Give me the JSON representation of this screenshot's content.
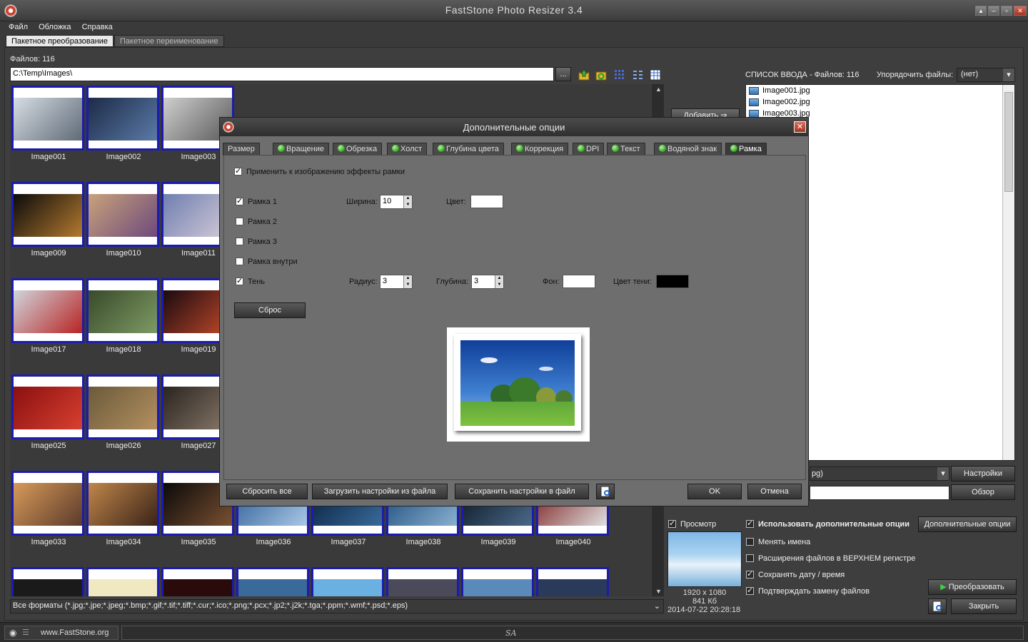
{
  "app": {
    "title": "FastStone Photo Resizer 3.4"
  },
  "menu": [
    "Файл",
    "Обложка",
    "Справка"
  ],
  "tabs": {
    "batch_convert": "Пакетное преобразование",
    "batch_rename": "Пакетное переименование"
  },
  "files_count": "Файлов: 116",
  "path": {
    "value": "C:\\Temp\\Images\\",
    "browse_label": "..."
  },
  "thumbnails": [
    {
      "label": "Image001",
      "c1": "#d7dde3",
      "c2": "#5f6b78"
    },
    {
      "label": "Image002",
      "c1": "#1d2b47",
      "c2": "#5a7aa7"
    },
    {
      "label": "Image003",
      "c1": "#cfcfcf",
      "c2": "#5a5a5a"
    },
    {
      "label": "Image009",
      "c1": "#0b0b0b",
      "c2": "#b47a2f"
    },
    {
      "label": "Image010",
      "c1": "#c8a27a",
      "c2": "#6e4a7c"
    },
    {
      "label": "Image011",
      "c1": "#6f7fb0",
      "c2": "#d6ccd8"
    },
    {
      "label": "Image017",
      "c1": "#d0d6dc",
      "c2": "#b82424"
    },
    {
      "label": "Image018",
      "c1": "#394a2a",
      "c2": "#7d9a64"
    },
    {
      "label": "Image019",
      "c1": "#1a0a10",
      "c2": "#c24a2a"
    },
    {
      "label": "Image025",
      "c1": "#8a1010",
      "c2": "#d84030"
    },
    {
      "label": "Image026",
      "c1": "#6a5a3a",
      "c2": "#b49060"
    },
    {
      "label": "Image027",
      "c1": "#2a2420",
      "c2": "#8a7a6a"
    },
    {
      "label": "Image033",
      "c1": "#d89a5a",
      "c2": "#5a3a2a"
    },
    {
      "label": "Image034",
      "c1": "#c0864a",
      "c2": "#3a2418"
    },
    {
      "label": "Image035",
      "c1": "#0a0a0a",
      "c2": "#7a5030"
    },
    {
      "label": "Image036",
      "c1": "#2c5c96",
      "c2": "#aac8e6"
    },
    {
      "label": "Image037",
      "c1": "#06203c",
      "c2": "#3a6a9a"
    },
    {
      "label": "Image038",
      "c1": "#1a4a7a",
      "c2": "#8ab0d0"
    },
    {
      "label": "Image039",
      "c1": "#0a1420",
      "c2": "#4a6a8a"
    },
    {
      "label": "Image040",
      "c1": "#7a1a1a",
      "c2": "#e0e0e0"
    }
  ],
  "format_filter": "Все форматы (*.jpg;*.jpe;*.jpeg;*.bmp;*.gif;*.tif;*.tiff;*.cur;*.ico;*.png;*.pcx;*.jp2;*.j2k;*.tga;*.ppm;*.wmf;*.psd;*.eps)",
  "input_list": {
    "header": "СПИСОК ВВОДА  -  Файлов: 116",
    "sort_label": "Упорядочить файлы:",
    "sort_value": "(нет)",
    "files": [
      "Image001.jpg",
      "Image002.jpg",
      "Image003.jpg"
    ]
  },
  "add_button": "Добавить",
  "output": {
    "format_value": "pg)",
    "settings_button": "Настройки",
    "browse_button": "Обзор"
  },
  "preview": {
    "label": "Просмотр",
    "resolution": "1920 x 1080",
    "size": "841 Кб",
    "date": "2014-07-22 20:28:18"
  },
  "options": {
    "use_advanced": "Использовать дополнительные опции",
    "advanced_button": "Дополнительные опции",
    "rename": "Менять имена",
    "uppercase_ext": "Расширения файлов в ВЕРХНЕМ регистре",
    "keep_date": "Сохранять дату / время",
    "confirm_replace": "Подтверждать замену файлов"
  },
  "convert_button": "Преобразовать",
  "close_button": "Закрыть",
  "status": {
    "url": "www.FastStone.org",
    "center": "SA"
  },
  "dialog": {
    "title": "Дополнительные опции",
    "tabs": [
      "Размер",
      "Вращение",
      "Обрезка",
      "Холст",
      "Глубина цвета",
      "Коррекция",
      "DPI",
      "Текст",
      "Водяной знак",
      "Рамка"
    ],
    "apply_frame": "Применить к изображению эффекты рамки",
    "frame1": "Рамка 1",
    "frame2": "Рамка 2",
    "frame3": "Рамка 3",
    "frame_inside": "Рамка внутри",
    "shadow": "Тень",
    "width_label": "Ширина:",
    "width_value": "10",
    "color_label": "Цвет:",
    "radius_label": "Радиус:",
    "radius_value": "3",
    "depth_label": "Глубина:",
    "depth_value": "3",
    "bg_label": "Фон:",
    "shadow_color_label": "Цвет тени:",
    "reset": "Сброс",
    "reset_all": "Сбросить все",
    "load_settings": "Загрузить настройки из файла",
    "save_settings": "Сохранить настройки в файл",
    "ok": "OK",
    "cancel": "Отмена",
    "colors": {
      "frame_color": "#ffffff",
      "background": "#ffffff",
      "shadow_color": "#000000"
    }
  }
}
